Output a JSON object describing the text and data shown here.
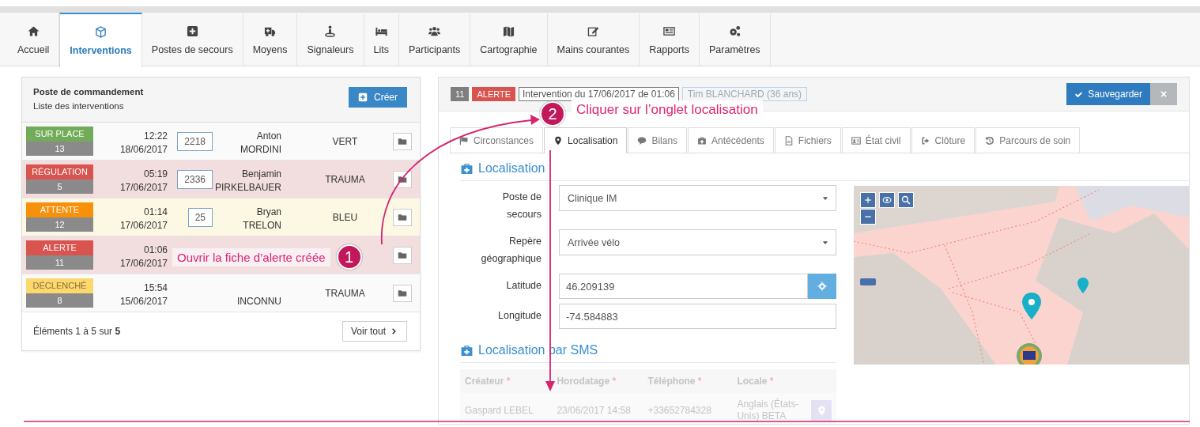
{
  "nav": {
    "tabs": [
      {
        "label": "Accueil",
        "selected": false
      },
      {
        "label": "Interventions",
        "selected": true
      },
      {
        "label": "Postes de secours",
        "selected": false
      },
      {
        "label": "Moyens",
        "selected": false
      },
      {
        "label": "Signaleurs",
        "selected": false
      },
      {
        "label": "Lits",
        "selected": false
      },
      {
        "label": "Participants",
        "selected": false
      },
      {
        "label": "Cartographie",
        "selected": false
      },
      {
        "label": "Mains courantes",
        "selected": false
      },
      {
        "label": "Rapports",
        "selected": false
      },
      {
        "label": "Paramètres",
        "selected": false
      }
    ]
  },
  "command_panel": {
    "title": "Poste de commandement",
    "subtitle": "Liste des interventions",
    "create_button": "Créer",
    "rows": [
      {
        "status": "SUR PLACE",
        "color": "#72ac5a",
        "number": "13",
        "kind": "plain",
        "time": "12:22",
        "date": "18/06/2017",
        "code": "2218",
        "name": [
          "Anton",
          "MORDINI"
        ],
        "category": "VERT"
      },
      {
        "status": "RÉGULATION",
        "color": "#d9534f",
        "number": "5",
        "kind": "danger",
        "time": "05:19",
        "date": "17/06/2017",
        "code": "2336",
        "name": [
          "Benjamin",
          "PIRKELBAUER"
        ],
        "category": "TRAUMA"
      },
      {
        "status": "ATTENTE",
        "color": "#f7900a",
        "number": "12",
        "kind": "warning",
        "time": "01:14",
        "date": "17/06/2017",
        "code": "25",
        "name": [
          "Bryan",
          "TRELON"
        ],
        "category": "BLEU"
      },
      {
        "status": "ALERTE",
        "color": "#d9534f",
        "number": "11",
        "kind": "danger",
        "time": "01:06",
        "date": "17/06/2017"
      },
      {
        "status": "DÉCLENCHÉ",
        "color": "#fdd86c",
        "number": "8",
        "kind": "plain",
        "time": "15:54",
        "date": "15/06/2017",
        "name": [
          "INCONNU"
        ],
        "category": "TRAUMA"
      }
    ],
    "footer": "Éléments 1 à 5 sur **5**",
    "more_button": "Voir tout"
  },
  "detail": {
    "number": "11",
    "status": {
      "label": "ALERTE",
      "color": "#d9534f"
    },
    "intervention": "Intervention du 17/06/2017 de 01:06",
    "patient": "Tim BLANCHARD (36 ans)",
    "save_button": "Sauvegarder",
    "close_button": "×",
    "tabs": [
      {
        "label": "Circonstances",
        "selected": false
      },
      {
        "label": "Localisation",
        "selected": true
      },
      {
        "label": "Bilans",
        "selected": false
      },
      {
        "label": "Antécédents",
        "selected": false
      },
      {
        "label": "Fichiers",
        "selected": false
      },
      {
        "label": "État civil",
        "selected": false
      },
      {
        "label": "Clôture",
        "selected": false
      },
      {
        "label": "Parcours de soin",
        "selected": false
      }
    ],
    "location": {
      "title": "Localisation",
      "fields": [
        {
          "kind": "select",
          "label": "Poste de secours",
          "value": "Clinique IM"
        },
        {
          "kind": "select",
          "label": "Repère géographique",
          "value": "Arrivée vélo"
        },
        {
          "kind": "geo",
          "label": "Latitude",
          "value": "46.209139"
        },
        {
          "kind": "text",
          "label": "Longitude",
          "value": "-74.584883"
        }
      ]
    },
    "sms": {
      "title": "Localisation par SMS",
      "columns": [
        {
          "label": "Créateur",
          "mark": "*"
        },
        {
          "label": "Horodatage",
          "mark": "*"
        },
        {
          "label": "Téléphone",
          "mark": "*"
        },
        {
          "label": "Locale",
          "mark": "*"
        }
      ],
      "rows": [
        {
          "creator": "Gaspard LEBEL",
          "timestamp": "23/06/2017 14:58",
          "phone": "+33652784328",
          "locale": "Anglais (États-Unis) BETA"
        }
      ]
    }
  },
  "annotations": [
    {
      "number": "1",
      "text": "Ouvrir la fiche d’alerte créée"
    },
    {
      "number": "2",
      "text": "Cliquer sur l’onglet localisation"
    }
  ]
}
